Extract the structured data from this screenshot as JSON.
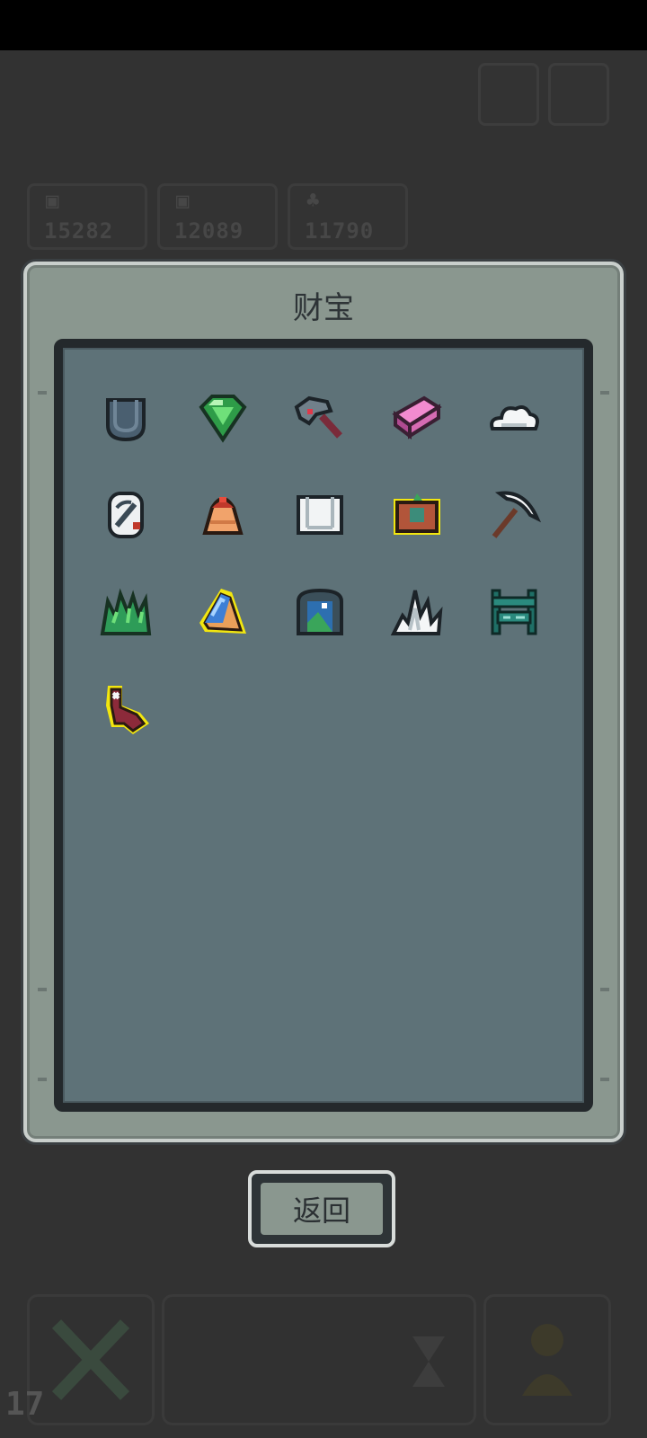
{
  "dialog": {
    "title": "财宝"
  },
  "buttons": {
    "back_label": "返回"
  },
  "background": {
    "resources": [
      {
        "icon": "gold-icon",
        "value": "15282"
      },
      {
        "icon": "gold-icon",
        "value": "12089"
      },
      {
        "icon": "food-icon",
        "value": "11790"
      }
    ],
    "level": "17"
  },
  "treasures": [
    {
      "name": "pocket-icon",
      "highlighted": false
    },
    {
      "name": "emerald-gem-icon",
      "highlighted": false
    },
    {
      "name": "hammer-icon",
      "highlighted": false
    },
    {
      "name": "pink-book-icon",
      "highlighted": false
    },
    {
      "name": "cloud-icon",
      "highlighted": false
    },
    {
      "name": "rune-stone-icon",
      "highlighted": false
    },
    {
      "name": "bell-icon",
      "highlighted": false
    },
    {
      "name": "scroll-icon",
      "highlighted": false
    },
    {
      "name": "framed-map-icon",
      "highlighted": true
    },
    {
      "name": "pickaxe-icon",
      "highlighted": false
    },
    {
      "name": "grass-icon",
      "highlighted": false
    },
    {
      "name": "blue-crystal-icon",
      "highlighted": true
    },
    {
      "name": "portal-gate-icon",
      "highlighted": false
    },
    {
      "name": "white-flame-icon",
      "highlighted": false
    },
    {
      "name": "bench-icon",
      "highlighted": false
    },
    {
      "name": "red-boot-icon",
      "highlighted": true
    }
  ],
  "colors": {
    "dialog_bg": "#8a978f",
    "inner_bg": "#5e7278",
    "highlight": "#f2e60f"
  }
}
